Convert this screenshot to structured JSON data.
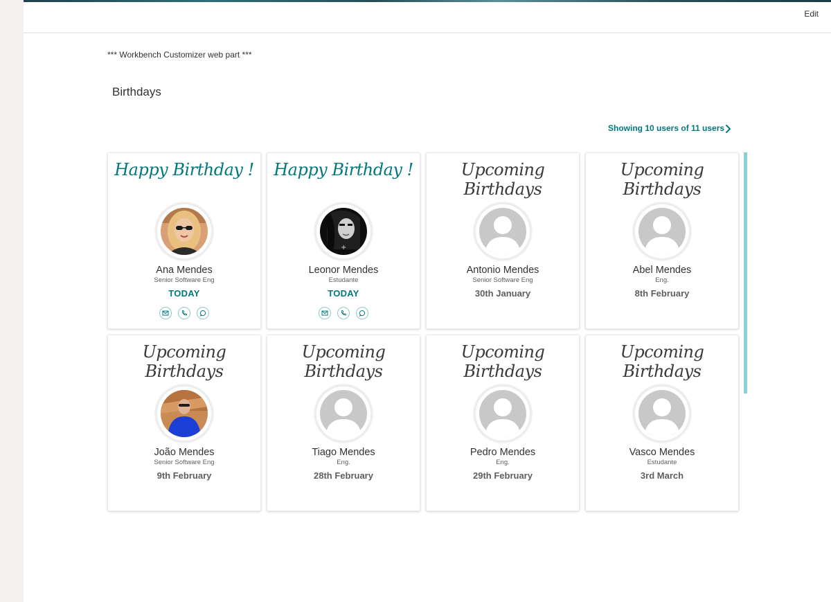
{
  "commandBar": {
    "edit_label": "Edit"
  },
  "customizer_text": "*** Workbench Customizer web part ***",
  "webpart": {
    "title": "Birthdays",
    "pager_text": "Showing 10 users of 11 users"
  },
  "colors": {
    "accent": "#03787c",
    "scroll_thumb": "#8fcfd6",
    "placeholder_avatar": "#c8c8c8"
  },
  "cards": [
    {
      "headline": "Happy Birthday !",
      "name": "Ana Mendes",
      "role": "Senior Software Eng",
      "date": "TODAY",
      "has_actions": true,
      "avatar": "photo"
    },
    {
      "headline": "Happy Birthday !",
      "name": "Leonor Mendes",
      "role": "Estudante",
      "date": "TODAY",
      "has_actions": true,
      "avatar": "photo"
    },
    {
      "headline": "Upcoming Birthdays",
      "name": "Antonio Mendes",
      "role": "Senior Software Eng",
      "date": "30th January",
      "has_actions": false,
      "avatar": "person-placeholder-icon"
    },
    {
      "headline": "Upcoming Birthdays",
      "name": "Abel Mendes",
      "role": "Eng.",
      "date": "8th February",
      "has_actions": false,
      "avatar": "person-placeholder-icon"
    },
    {
      "headline": "Upcoming Birthdays",
      "name": "João Mendes",
      "role": "Senior Software Eng",
      "date": "9th February",
      "has_actions": false,
      "avatar": "photo"
    },
    {
      "headline": "Upcoming Birthdays",
      "name": "Tiago Mendes",
      "role": "Eng.",
      "date": "28th February",
      "has_actions": false,
      "avatar": "person-placeholder-icon"
    },
    {
      "headline": "Upcoming Birthdays",
      "name": "Pedro Mendes",
      "role": "Eng.",
      "date": "29th February",
      "has_actions": false,
      "avatar": "person-placeholder-icon"
    },
    {
      "headline": "Upcoming Birthdays",
      "name": "Vasco Mendes",
      "role": "Estudante",
      "date": "3rd March",
      "has_actions": false,
      "avatar": "person-placeholder-icon"
    }
  ],
  "action_icons": [
    "mail-icon",
    "phone-icon",
    "chat-icon"
  ]
}
